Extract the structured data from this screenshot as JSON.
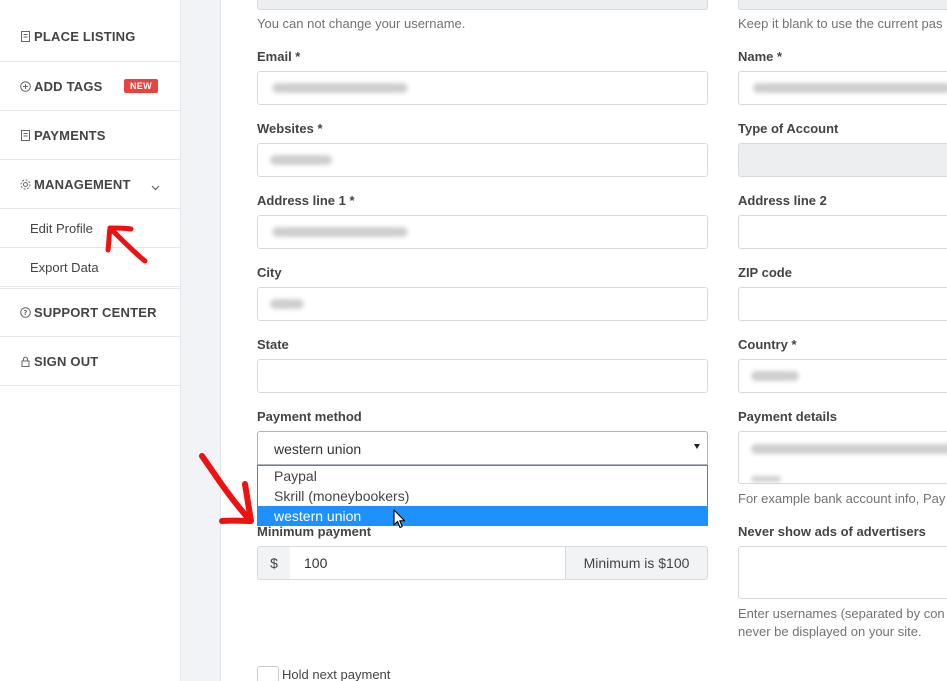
{
  "sidebar": {
    "items": [
      {
        "label": "PLACE LISTING",
        "icon": "document-icon"
      },
      {
        "label": "ADD TAGS",
        "icon": "plus-circle-icon",
        "badge": "NEW"
      },
      {
        "label": "PAYMENTS",
        "icon": "document-icon"
      },
      {
        "label": "MANAGEMENT",
        "icon": "gear-icon"
      },
      {
        "label": "SUPPORT CENTER",
        "icon": "help-circle-icon"
      },
      {
        "label": "SIGN OUT",
        "icon": "lock-icon"
      }
    ],
    "sub_items": [
      {
        "label": "Edit Profile"
      },
      {
        "label": "Export Data"
      }
    ]
  },
  "form": {
    "username_help": "You can not change your username.",
    "password_help": "Keep it blank to use the current pas",
    "email_label": "Email *",
    "name_label": "Name *",
    "websites_label": "Websites *",
    "account_type_label": "Type of Account",
    "address1_label": "Address line 1 *",
    "address2_label": "Address line 2",
    "city_label": "City",
    "zip_label": "ZIP code",
    "state_label": "State",
    "country_label": "Country *",
    "payment_method_label": "Payment method",
    "payment_method_value": "western union",
    "payment_options": [
      "Paypal",
      "Skrill (moneybookers)",
      "western union"
    ],
    "payment_details_label": "Payment details",
    "payment_details_help": "For example bank account info, Pay",
    "min_payment_label": "Minimum payment",
    "currency": "$",
    "min_payment_value": "100",
    "min_payment_hint": "Minimum is $100",
    "never_show_label": "Never show ads of advertisers",
    "never_show_help_1": "Enter usernames (separated by con",
    "never_show_help_2": "never be displayed on your site.",
    "hold_payment_label": "Hold next payment"
  },
  "colors": {
    "accent": "#1e90ff",
    "badge": "#e9433f",
    "annotation": "#ee1111"
  }
}
